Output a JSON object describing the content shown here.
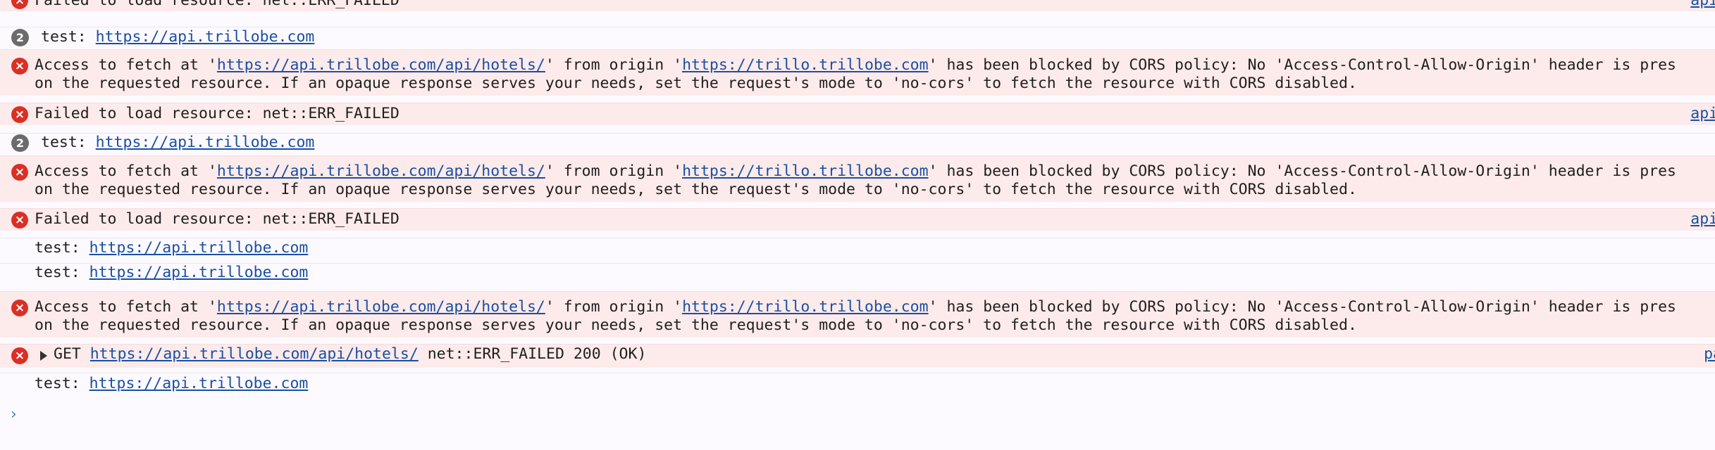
{
  "console": {
    "row0": {
      "text": "Failed to load resource: net::ERR_FAILED",
      "source": "api.t"
    },
    "row1": {
      "count": "2",
      "prefix": "test: ",
      "url": "https://api.trillobe.com"
    },
    "row2": {
      "line1_a": "Access to fetch at '",
      "line1_url1": "https://api.trillobe.com/api/hotels/",
      "line1_b": "' from origin '",
      "line1_url2": "https://trillo.trillobe.com",
      "line1_c": "' has been blocked by CORS policy: No 'Access-Control-Allow-Origin' header is pres",
      "line2": "on the requested resource. If an opaque response serves your needs, set the request's mode to 'no-cors' to fetch the resource with CORS disabled."
    },
    "row3": {
      "text": "Failed to load resource: net::ERR_FAILED",
      "source": "api.t"
    },
    "row4": {
      "count": "2",
      "prefix": "test: ",
      "url": "https://api.trillobe.com"
    },
    "row5": {
      "line1_a": "Access to fetch at '",
      "line1_url1": "https://api.trillobe.com/api/hotels/",
      "line1_b": "' from origin '",
      "line1_url2": "https://trillo.trillobe.com",
      "line1_c": "' has been blocked by CORS policy: No 'Access-Control-Allow-Origin' header is pres",
      "line2": "on the requested resource. If an opaque response serves your needs, set the request's mode to 'no-cors' to fetch the resource with CORS disabled."
    },
    "row6": {
      "text": "Failed to load resource: net::ERR_FAILED",
      "source": "api.t"
    },
    "row7": {
      "prefix": "test: ",
      "url": "https://api.trillobe.com"
    },
    "row8": {
      "prefix": "test: ",
      "url": "https://api.trillobe.com"
    },
    "row9": {
      "line1_a": "Access to fetch at '",
      "line1_url1": "https://api.trillobe.com/api/hotels/",
      "line1_b": "' from origin '",
      "line1_url2": "https://trillo.trillobe.com",
      "line1_c": "' has been blocked by CORS policy: No 'Access-Control-Allow-Origin' header is pres",
      "line2": "on the requested resource. If an opaque response serves your needs, set the request's mode to 'no-cors' to fetch the resource with CORS disabled."
    },
    "row10": {
      "method": "GET ",
      "url": "https://api.trillobe.com/api/hotels/",
      "status": " net::ERR_FAILED 200 (OK)",
      "source": "pa"
    },
    "row11": {
      "prefix": "test: ",
      "url": "https://api.trillobe.com"
    },
    "prompt_symbol": "›"
  },
  "colors": {
    "error_background": "#fcebea",
    "error_icon": "#d93026",
    "link": "#1a4fa3",
    "badge": "#6b6b6b"
  },
  "icons": {
    "error": "error-circle-x-icon",
    "expand": "triangle-right-icon",
    "prompt": "chevron-right-icon"
  }
}
